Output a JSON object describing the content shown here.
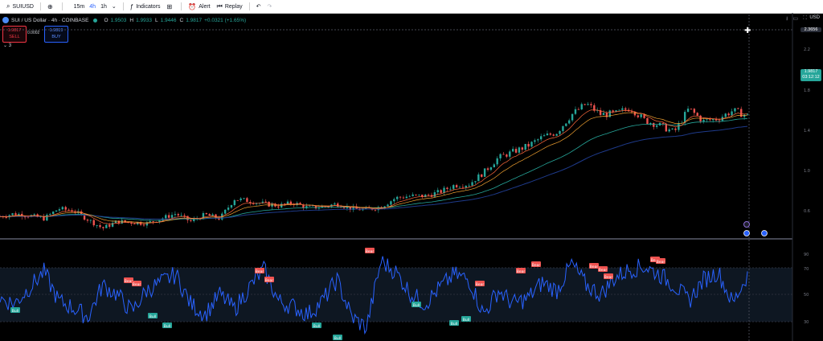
{
  "toolbar": {
    "symbol": "SUIUSD",
    "timeframes": [
      "15m",
      "4h",
      "1h"
    ],
    "active_timeframe": "4h",
    "indicators_label": "Indicators",
    "alert_label": "Alert",
    "replay_label": "Replay"
  },
  "legend": {
    "title": "SUI / US Dollar · 4h · COINBASE",
    "ohlc": {
      "O": "1.9503",
      "H": "1.9933",
      "L": "1.9446",
      "C": "1.9817",
      "change": "+0.0321 (+1.65%)"
    }
  },
  "trade": {
    "sell_price": "1.9817",
    "sell_label": "SELL",
    "spread": "0.0002",
    "buy_price": "1.9819",
    "buy_label": "BUY",
    "collapsed_count": "3"
  },
  "price_axis": {
    "currency": "USD",
    "crosshair_price": "2.3656",
    "last_price": "1.9817",
    "countdown": "03:12:12"
  },
  "colors": {
    "bull": "#26a69a",
    "bear": "#ef5350",
    "rsi": "#2962ff",
    "ema_fast": "#ff6a3d",
    "ema_mid": "#f0a030",
    "ema_slow": "#26a69a",
    "sma": "#1e3a8a"
  },
  "rsi_panel": {
    "bear_label": "Bear",
    "bull_label": "Bull"
  },
  "chart_data": {
    "type": "line",
    "series": [
      {
        "values": [
          0.52,
          0.55,
          0.53,
          0.5,
          0.6,
          0.58,
          0.49,
          0.4,
          0.47,
          0.46,
          0.45,
          0.5,
          0.55,
          0.47,
          0.54,
          0.5,
          0.7,
          0.68,
          0.65,
          0.63,
          0.66,
          0.61,
          0.62,
          0.65,
          0.6,
          0.59,
          0.62,
          0.71,
          0.73,
          0.73,
          0.77,
          0.84,
          0.85,
          0.97,
          1.12,
          1.18,
          1.24,
          1.33,
          1.38,
          1.56,
          1.67,
          1.56,
          1.57,
          1.63,
          1.5,
          1.45,
          1.38,
          1.62,
          1.49,
          1.52,
          1.6,
          1.55
        ]
      },
      {
        "values": [
          52,
          48,
          60,
          72,
          50,
          45,
          38,
          62,
          55,
          42,
          58,
          64,
          70,
          48,
          40,
          55,
          44,
          60,
          74,
          50,
          46,
          40,
          50,
          66,
          38,
          30,
          80,
          72,
          56,
          48,
          60,
          70,
          66,
          40,
          58,
          48,
          52,
          64,
          58,
          78,
          62,
          55,
          68,
          74,
          76,
          70,
          62,
          50,
          66,
          72,
          48,
          70
        ]
      }
    ]
  }
}
